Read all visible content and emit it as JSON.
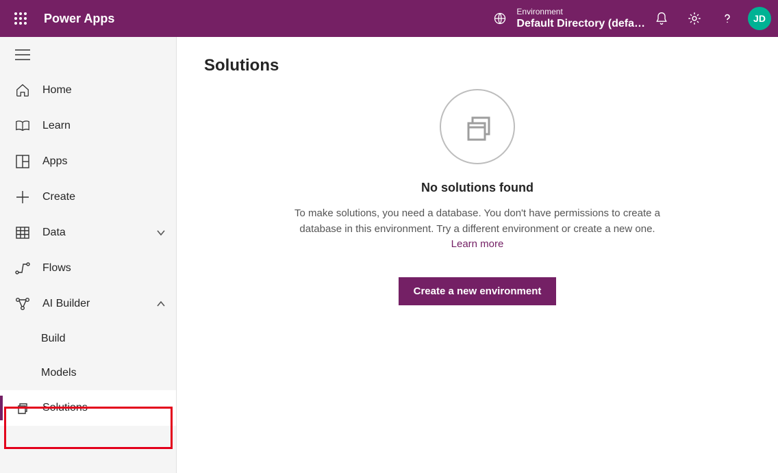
{
  "header": {
    "brand": "Power Apps",
    "env_label": "Environment",
    "env_value": "Default Directory (defa…",
    "avatar_initials": "JD"
  },
  "sidebar": {
    "items": [
      {
        "id": "home",
        "label": "Home"
      },
      {
        "id": "learn",
        "label": "Learn"
      },
      {
        "id": "apps",
        "label": "Apps"
      },
      {
        "id": "create",
        "label": "Create"
      },
      {
        "id": "data",
        "label": "Data",
        "expandable": true,
        "expanded": false
      },
      {
        "id": "flows",
        "label": "Flows"
      },
      {
        "id": "ai-builder",
        "label": "AI Builder",
        "expandable": true,
        "expanded": true,
        "children": [
          {
            "id": "build",
            "label": "Build"
          },
          {
            "id": "models",
            "label": "Models"
          }
        ]
      },
      {
        "id": "solutions",
        "label": "Solutions",
        "selected": true
      }
    ]
  },
  "main": {
    "title": "Solutions",
    "empty_title": "No solutions found",
    "empty_desc": "To make solutions, you need a database. You don't have permissions to create a database in this environment. Try a different environment or create a new one.",
    "learn_more": "Learn more",
    "primary_button": "Create a new environment"
  }
}
